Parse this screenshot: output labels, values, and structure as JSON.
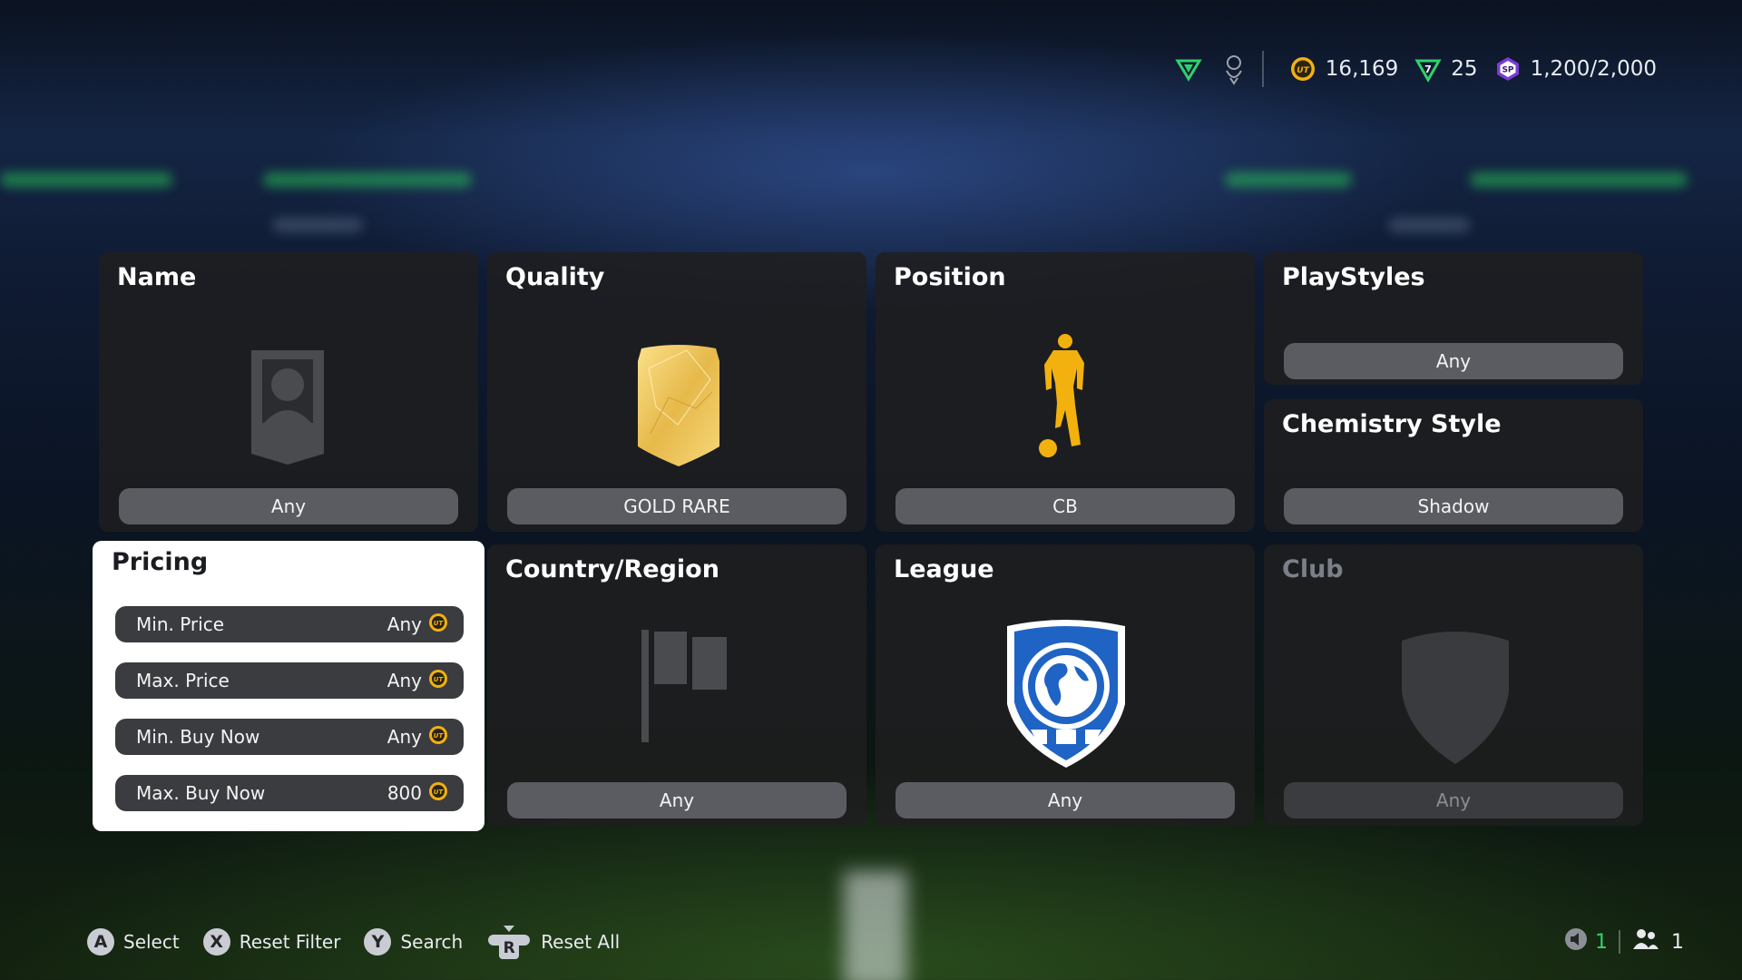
{
  "topbar": {
    "coins": "16,169",
    "fc_points": "25",
    "sp": "1,200/2,000"
  },
  "tiles": {
    "name": {
      "title": "Name",
      "value": "Any"
    },
    "quality": {
      "title": "Quality",
      "value": "GOLD RARE"
    },
    "position": {
      "title": "Position",
      "value": "CB"
    },
    "playstyles": {
      "title": "PlayStyles",
      "value": "Any"
    },
    "chemistry": {
      "title": "Chemistry Style",
      "value": "Shadow"
    },
    "country": {
      "title": "Country/Region",
      "value": "Any"
    },
    "league": {
      "title": "League",
      "value": "Any"
    },
    "club": {
      "title": "Club",
      "value": "Any"
    }
  },
  "pricing": {
    "title": "Pricing",
    "rows": [
      {
        "label": "Min. Price",
        "value": "Any"
      },
      {
        "label": "Max. Price",
        "value": "Any"
      },
      {
        "label": "Min. Buy Now",
        "value": "Any"
      },
      {
        "label": "Max. Buy Now",
        "value": "800"
      }
    ]
  },
  "controls": {
    "select": {
      "key": "A",
      "label": "Select"
    },
    "reset_filter": {
      "key": "X",
      "label": "Reset Filter"
    },
    "search": {
      "key": "Y",
      "label": "Search"
    },
    "reset_all": {
      "key": "R",
      "label": "Reset All"
    }
  },
  "status": {
    "mic_count": "1",
    "party_count": "1"
  },
  "colors": {
    "accent_green": "#31d16a",
    "gold": "#f2b10f",
    "tile_bg": "#1e1e20",
    "pill_bg": "#5a5c61"
  }
}
